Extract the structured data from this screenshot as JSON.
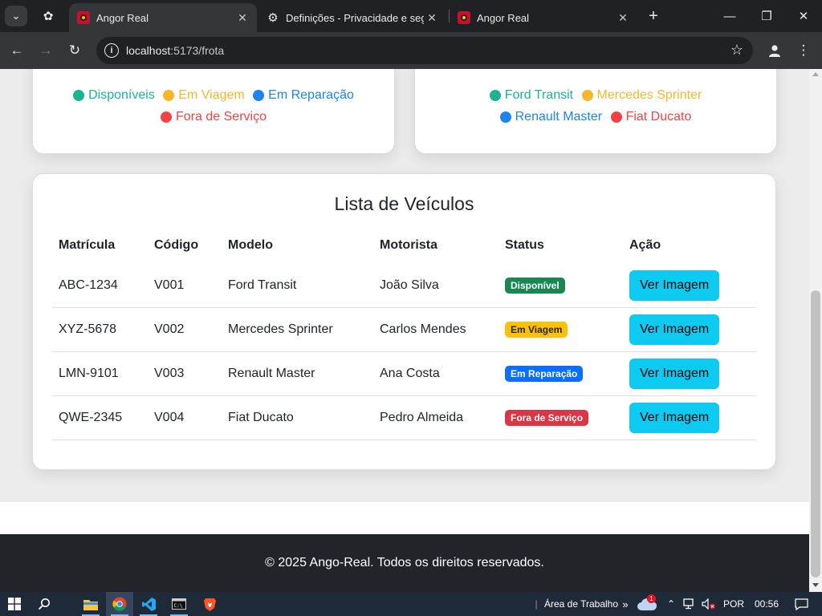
{
  "browser": {
    "tabs": [
      {
        "title": "Angor Real",
        "active": true
      },
      {
        "title": "Definições - Privacidade e segur",
        "active": false
      },
      {
        "title": "Angor Real",
        "active": false
      }
    ],
    "url": {
      "host": "localhost",
      "path": ":5173/frota"
    }
  },
  "charts": [
    {
      "chart_data": {
        "type": "pie",
        "legend_position": "bottom",
        "series": [
          {
            "name": "Disponíveis",
            "color": "#1ab394"
          },
          {
            "name": "Em Viagem",
            "color": "#f8b72b"
          },
          {
            "name": "Em Reparação",
            "color": "#1c84ee"
          },
          {
            "name": "Fora de Serviço",
            "color": "#f44242"
          }
        ]
      }
    },
    {
      "chart_data": {
        "type": "pie",
        "legend_position": "bottom",
        "series": [
          {
            "name": "Ford Transit",
            "color": "#1ab394"
          },
          {
            "name": "Mercedes Sprinter",
            "color": "#f8b72b"
          },
          {
            "name": "Renault Master",
            "color": "#1c84ee"
          },
          {
            "name": "Fiat Ducato",
            "color": "#f44242"
          }
        ]
      }
    }
  ],
  "vehicle_list": {
    "title": "Lista de Veículos",
    "headers": [
      "Matrícula",
      "Código",
      "Modelo",
      "Motorista",
      "Status",
      "Ação"
    ],
    "rows": [
      {
        "plate": "ABC-1234",
        "code": "V001",
        "model": "Ford Transit",
        "driver": "João Silva",
        "status": "Disponível",
        "status_color": "#198754",
        "action": "Ver Imagem"
      },
      {
        "plate": "XYZ-5678",
        "code": "V002",
        "model": "Mercedes Sprinter",
        "driver": "Carlos Mendes",
        "status": "Em Viagem",
        "status_color": "#ffc107",
        "action": "Ver Imagem"
      },
      {
        "plate": "LMN-9101",
        "code": "V003",
        "model": "Renault Master",
        "driver": "Ana Costa",
        "status": "Em Reparação",
        "status_color": "#0d6efd",
        "action": "Ver Imagem"
      },
      {
        "plate": "QWE-2345",
        "code": "V004",
        "model": "Fiat Ducato",
        "driver": "Pedro Almeida",
        "status": "Fora de Serviço",
        "status_color": "#dc3545",
        "action": "Ver Imagem"
      }
    ]
  },
  "footer": {
    "text": "© 2025 Ango-Real. Todos os direitos reservados."
  },
  "taskbar": {
    "desktop_label": "Área de Trabalho",
    "weather_badge": "1",
    "language": "POR",
    "time": "00:56"
  }
}
